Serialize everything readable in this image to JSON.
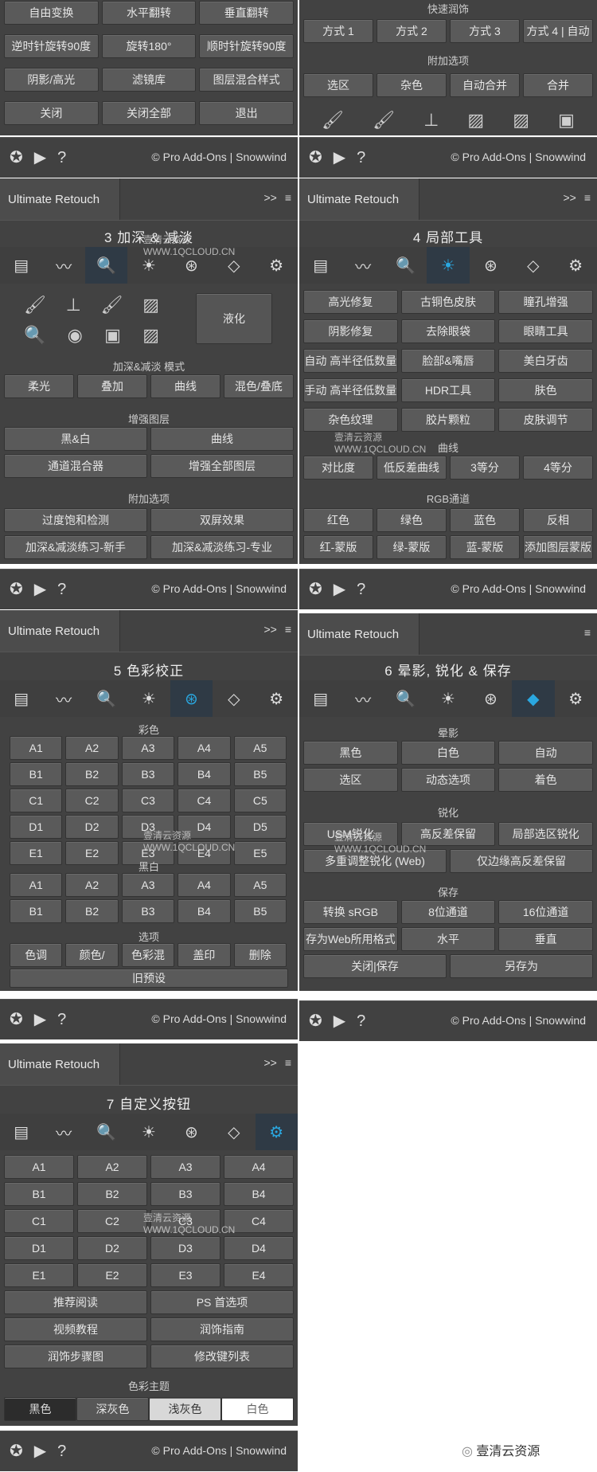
{
  "panel_1": {
    "rows": [
      [
        "自由变换",
        "水平翻转",
        "垂直翻转"
      ],
      [
        "逆时针旋转90度",
        "旋转180°",
        "顺时针旋转90度"
      ],
      [
        "阴影/高光",
        "滤镜库",
        "图层混合样式"
      ],
      [
        "关闭",
        "关闭全部",
        "退出"
      ]
    ]
  },
  "panel_2": {
    "section_top": "快速润饰",
    "method_buttons": [
      "方式 1",
      "方式 2",
      "方式 3",
      "方式 4 | 自动"
    ],
    "section_extra": "附加选项",
    "extra_buttons": [
      "选区",
      "杂色",
      "自动合并",
      "合并"
    ]
  },
  "footer": {
    "credit": "© Pro Add-Ons | Snowwind"
  },
  "header": {
    "title": "Ultimate Retouch",
    "expand_glyph": ">>",
    "menu_glyph": "≡"
  },
  "panel_3": {
    "title": "3 加深 & 减淡",
    "liquify": "液化",
    "mode_section": "加深&减淡 模式",
    "mode_buttons": [
      "柔光",
      "叠加",
      "曲线",
      "混色/叠底"
    ],
    "enhance_section": "增强图层",
    "enhance_buttons": [
      "黑&白",
      "曲线"
    ],
    "enhance_buttons2": [
      "通道混合器",
      "增强全部图层"
    ],
    "extra_section": "附加选项",
    "extra_buttons": [
      "过度饱和检测",
      "双屏效果",
      "加深&减淡练习-新手",
      "加深&减淡练习-专业"
    ]
  },
  "panel_4": {
    "title": "4 局部工具",
    "buttons": [
      [
        "高光修复",
        "古铜色皮肤",
        "瞳孔增强"
      ],
      [
        "阴影修复",
        "去除眼袋",
        "眼睛工具"
      ],
      [
        "自动 高半径低数量",
        "脸部&嘴唇",
        "美白牙齿"
      ],
      [
        "手动 高半径低数量",
        "HDR工具",
        "肤色"
      ],
      [
        "杂色纹理",
        "胶片颗粒",
        "皮肤调节"
      ]
    ],
    "curve_section": "曲线",
    "curve_buttons": [
      "对比度",
      "低反差曲线",
      "3等分",
      "4等分"
    ],
    "rgb_section": "RGB通道",
    "rgb_buttons": [
      "红色",
      "绿色",
      "蓝色",
      "反相"
    ],
    "rgb_buttons2": [
      "红-蒙版",
      "绿-蒙版",
      "蓝-蒙版",
      "添加图层蒙版"
    ]
  },
  "panel_5": {
    "title": "5 色彩校正",
    "color_section": "彩色",
    "color_rows": [
      [
        "A1",
        "A2",
        "A3",
        "A4",
        "A5"
      ],
      [
        "B1",
        "B2",
        "B3",
        "B4",
        "B5"
      ],
      [
        "C1",
        "C2",
        "C3",
        "C4",
        "C5"
      ],
      [
        "D1",
        "D2",
        "D3",
        "D4",
        "D5"
      ],
      [
        "E1",
        "E2",
        "E3",
        "E4",
        "E5"
      ]
    ],
    "bw_section": "黑白",
    "bw_rows": [
      [
        "A1",
        "A2",
        "A3",
        "A4",
        "A5"
      ],
      [
        "B1",
        "B2",
        "B3",
        "B4",
        "B5"
      ]
    ],
    "options_section": "选项",
    "options_buttons": [
      "色调",
      "颜色/",
      "色彩混",
      "盖印",
      "删除"
    ],
    "preset_button": "旧预设"
  },
  "panel_6": {
    "title": "6 晕影, 锐化 & 保存",
    "vignette_section": "晕影",
    "vignette_buttons": [
      "黑色",
      "白色",
      "自动",
      "选区",
      "动态选项",
      "着色"
    ],
    "sharpen_section": "锐化",
    "sharpen_buttons": [
      "USM锐化",
      "高反差保留",
      "局部选区锐化"
    ],
    "sharpen_buttons2": [
      "多重调整锐化 (Web)",
      "仅边缘高反差保留"
    ],
    "save_section": "保存",
    "save_buttons": [
      "转换 sRGB",
      "8位通道",
      "16位通道"
    ],
    "save_buttons2": [
      "存为Web所用格式",
      "水平",
      "垂直"
    ],
    "save_buttons3": [
      "关闭|保存",
      "另存为"
    ]
  },
  "panel_7": {
    "title": "7 自定义按钮",
    "rows": [
      [
        "A1",
        "A2",
        "A3",
        "A4"
      ],
      [
        "B1",
        "B2",
        "B3",
        "B4"
      ],
      [
        "C1",
        "C2",
        "C3",
        "C4"
      ],
      [
        "D1",
        "D2",
        "D3",
        "D4"
      ],
      [
        "E1",
        "E2",
        "E3",
        "E4"
      ]
    ],
    "bottom_buttons": [
      "推荐阅读",
      "PS 首选项",
      "视频教程",
      "润饰指南",
      "润饰步骤图",
      "修改键列表"
    ],
    "theme_section": "色彩主题",
    "theme_buttons": [
      "黑色",
      "深灰色",
      "浅灰色",
      "白色"
    ]
  },
  "watermark": {
    "cn": "壹清云资源",
    "url": "WWW.1QCLOUD.CN"
  },
  "brand_mark": "壹清云资源",
  "colors": {
    "panel": "#424242",
    "button": "#5a5a5a",
    "accent": "#2aa7e0"
  }
}
